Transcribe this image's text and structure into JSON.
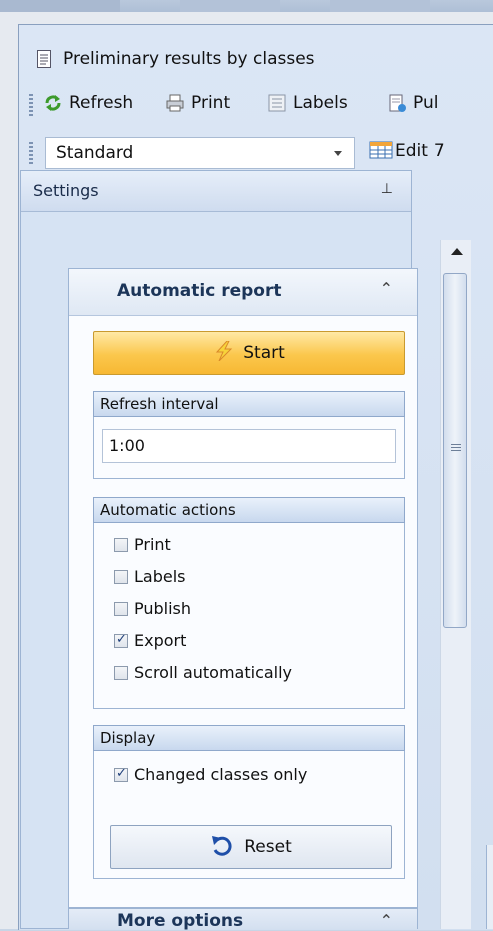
{
  "window": {
    "title": "Preliminary results by classes"
  },
  "toolbar": {
    "items": [
      {
        "label": "Refresh",
        "icon": "refresh-icon"
      },
      {
        "label": "Print",
        "icon": "printer-icon"
      },
      {
        "label": "Labels",
        "icon": "labels-icon"
      },
      {
        "label": "Pul",
        "icon": "publish-icon"
      }
    ]
  },
  "toolbar2": {
    "combo_value": "Standard",
    "edit_label": "Edit",
    "edit_extra": "7"
  },
  "settings_panel": {
    "title": "Settings",
    "pin_glyph": "⊥"
  },
  "auto_report": {
    "title": "Automatic report",
    "collapse_glyph": "⌃",
    "start_label": "Start",
    "refresh_interval": {
      "header": "Refresh interval",
      "value": "1:00"
    },
    "automatic_actions": {
      "header": "Automatic actions",
      "items": [
        {
          "label": "Print",
          "checked": false
        },
        {
          "label": "Labels",
          "checked": false
        },
        {
          "label": "Publish",
          "checked": false
        },
        {
          "label": "Export",
          "checked": true
        },
        {
          "label": "Scroll automatically",
          "checked": false
        }
      ]
    },
    "display": {
      "header": "Display",
      "changed_only_label": "Changed classes only",
      "changed_only_checked": true,
      "reset_label": "Reset"
    }
  },
  "more_options": {
    "title": "More options"
  },
  "colors": {
    "start_button": "#fbc74c",
    "panel_bg": "#d6e3f3",
    "accent_border": "#9db4d3"
  }
}
